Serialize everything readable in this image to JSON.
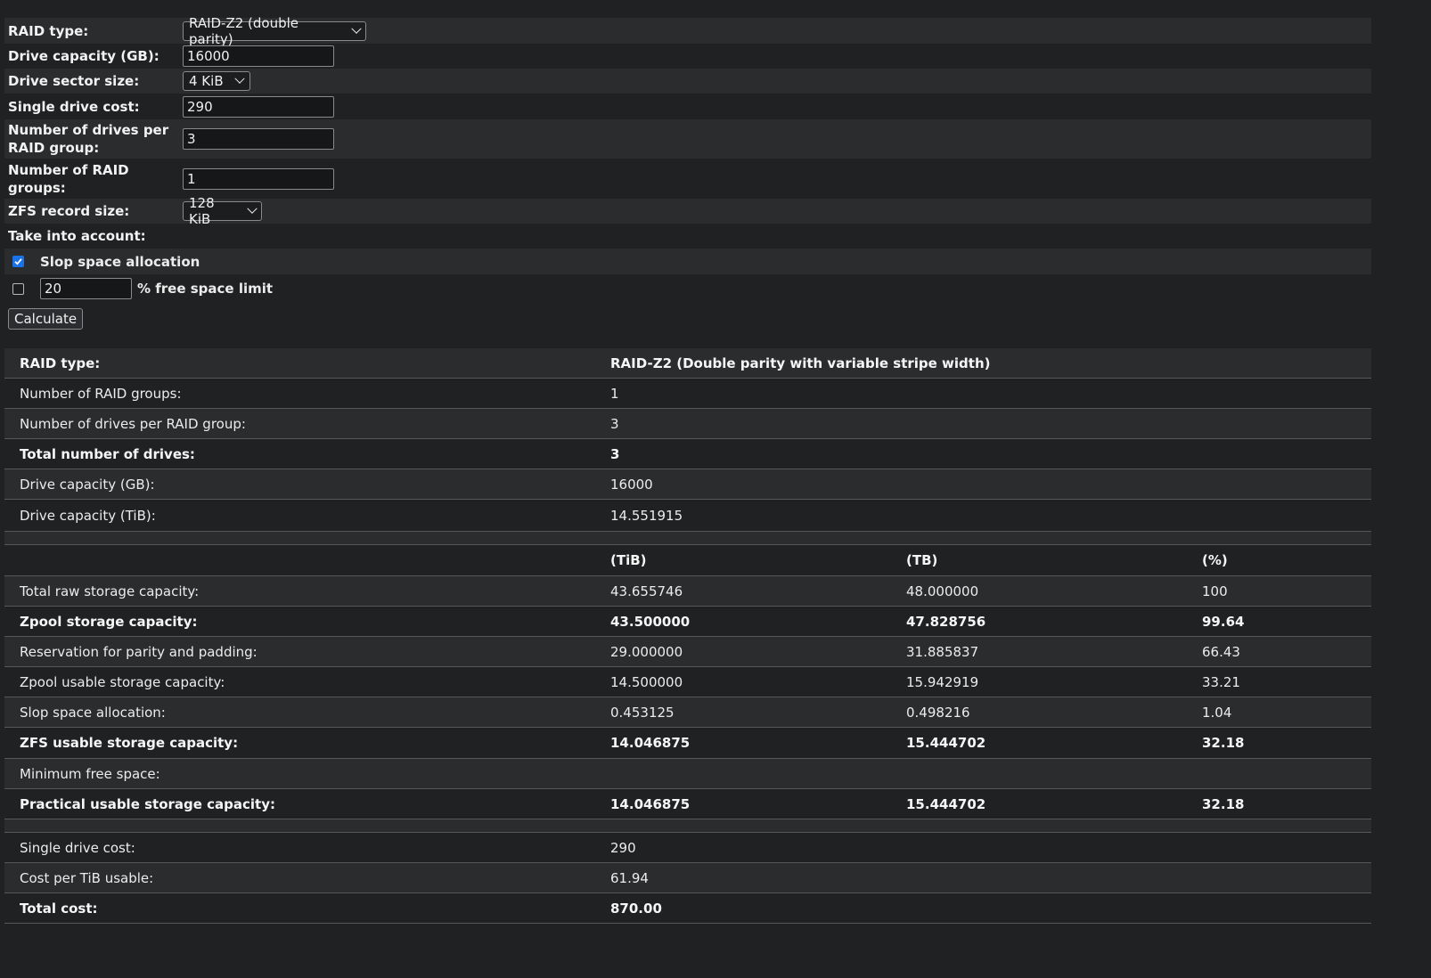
{
  "form": {
    "raid_type": {
      "label": "RAID type:",
      "value": "RAID-Z2 (double parity)"
    },
    "drive_capacity": {
      "label": "Drive capacity (GB):",
      "value": "16000"
    },
    "sector_size": {
      "label": "Drive sector size:",
      "value": "4 KiB"
    },
    "drive_cost": {
      "label": "Single drive cost:",
      "value": "290"
    },
    "drives_per_group": {
      "label": "Number of drives per RAID group:",
      "value": "3"
    },
    "raid_groups": {
      "label": "Number of RAID groups:",
      "value": "1"
    },
    "record_size": {
      "label": "ZFS record size:",
      "value": "128 KiB"
    },
    "take_into_account": "Take into account:",
    "slop": {
      "label": "Slop space allocation",
      "checked": true
    },
    "free_space": {
      "value": "20",
      "label": "% free space limit",
      "checked": false
    },
    "calculate_label": "Calculate"
  },
  "results": {
    "info": [
      {
        "label": "RAID type:",
        "value": "RAID-Z2 (Double parity with variable stripe width)",
        "bold": true
      },
      {
        "label": "Number of RAID groups:",
        "value": "1",
        "bold": false
      },
      {
        "label": "Number of drives per RAID group:",
        "value": "3",
        "bold": false
      },
      {
        "label": "Total number of drives:",
        "value": "3",
        "bold": true
      },
      {
        "label": "Drive capacity (GB):",
        "value": "16000",
        "bold": false
      },
      {
        "label": "Drive capacity (TiB):",
        "value": "14.551915",
        "bold": false
      }
    ],
    "columns": [
      "(TiB)",
      "(TB)",
      "(%)"
    ],
    "capacity": [
      {
        "label": "Total raw storage capacity:",
        "tib": "43.655746",
        "tb": "48.000000",
        "pct": "100",
        "bold": false
      },
      {
        "label": "Zpool storage capacity:",
        "tib": "43.500000",
        "tb": "47.828756",
        "pct": "99.64",
        "bold": true
      },
      {
        "label": "Reservation for parity and padding:",
        "tib": "29.000000",
        "tb": "31.885837",
        "pct": "66.43",
        "bold": false
      },
      {
        "label": "Zpool usable storage capacity:",
        "tib": "14.500000",
        "tb": "15.942919",
        "pct": "33.21",
        "bold": false
      },
      {
        "label": "Slop space allocation:",
        "tib": "0.453125",
        "tb": "0.498216",
        "pct": "1.04",
        "bold": false
      },
      {
        "label": "ZFS usable storage capacity:",
        "tib": "14.046875",
        "tb": "15.444702",
        "pct": "32.18",
        "bold": true
      },
      {
        "label": "Minimum free space:",
        "tib": "",
        "tb": "",
        "pct": "",
        "bold": false
      },
      {
        "label": "Practical usable storage capacity:",
        "tib": "14.046875",
        "tb": "15.444702",
        "pct": "32.18",
        "bold": true
      }
    ],
    "cost": [
      {
        "label": "Single drive cost:",
        "value": "290",
        "bold": false
      },
      {
        "label": "Cost per TiB usable:",
        "value": "61.94",
        "bold": false
      },
      {
        "label": "Total cost:",
        "value": "870.00",
        "bold": true
      }
    ]
  }
}
